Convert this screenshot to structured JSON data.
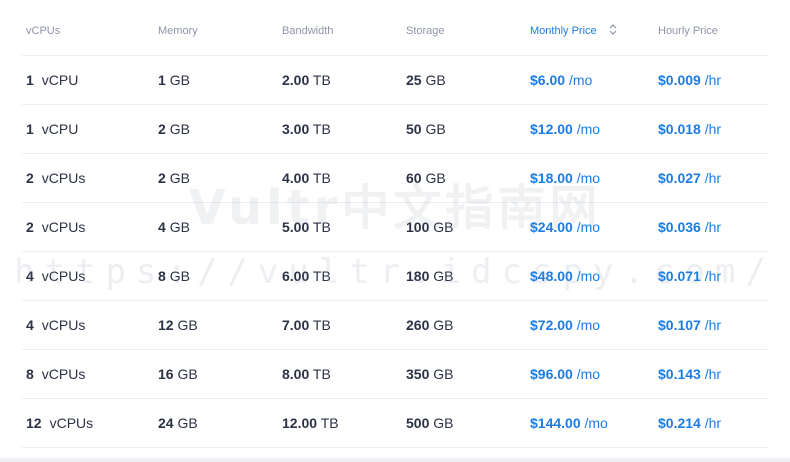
{
  "table": {
    "headers": {
      "vcpus": "vCPUs",
      "memory": "Memory",
      "bandwidth": "Bandwidth",
      "storage": "Storage",
      "monthly": "Monthly Price",
      "hourly": "Hourly Price"
    },
    "sort_icon": "sort-updown-icon",
    "rows": [
      {
        "cpu": "1",
        "cpu_unit": "vCPU",
        "mem": "1",
        "mem_unit": "GB",
        "bw": "2.00",
        "bw_unit": "TB",
        "storage": "25",
        "storage_unit": "GB",
        "monthly": "$6.00",
        "monthly_unit": "/mo",
        "hourly": "$0.009",
        "hourly_unit": "/hr"
      },
      {
        "cpu": "1",
        "cpu_unit": "vCPU",
        "mem": "2",
        "mem_unit": "GB",
        "bw": "3.00",
        "bw_unit": "TB",
        "storage": "50",
        "storage_unit": "GB",
        "monthly": "$12.00",
        "monthly_unit": "/mo",
        "hourly": "$0.018",
        "hourly_unit": "/hr"
      },
      {
        "cpu": "2",
        "cpu_unit": "vCPUs",
        "mem": "2",
        "mem_unit": "GB",
        "bw": "4.00",
        "bw_unit": "TB",
        "storage": "60",
        "storage_unit": "GB",
        "monthly": "$18.00",
        "monthly_unit": "/mo",
        "hourly": "$0.027",
        "hourly_unit": "/hr"
      },
      {
        "cpu": "2",
        "cpu_unit": "vCPUs",
        "mem": "4",
        "mem_unit": "GB",
        "bw": "5.00",
        "bw_unit": "TB",
        "storage": "100",
        "storage_unit": "GB",
        "monthly": "$24.00",
        "monthly_unit": "/mo",
        "hourly": "$0.036",
        "hourly_unit": "/hr"
      },
      {
        "cpu": "4",
        "cpu_unit": "vCPUs",
        "mem": "8",
        "mem_unit": "GB",
        "bw": "6.00",
        "bw_unit": "TB",
        "storage": "180",
        "storage_unit": "GB",
        "monthly": "$48.00",
        "monthly_unit": "/mo",
        "hourly": "$0.071",
        "hourly_unit": "/hr"
      },
      {
        "cpu": "4",
        "cpu_unit": "vCPUs",
        "mem": "12",
        "mem_unit": "GB",
        "bw": "7.00",
        "bw_unit": "TB",
        "storage": "260",
        "storage_unit": "GB",
        "monthly": "$72.00",
        "monthly_unit": "/mo",
        "hourly": "$0.107",
        "hourly_unit": "/hr"
      },
      {
        "cpu": "8",
        "cpu_unit": "vCPUs",
        "mem": "16",
        "mem_unit": "GB",
        "bw": "8.00",
        "bw_unit": "TB",
        "storage": "350",
        "storage_unit": "GB",
        "monthly": "$96.00",
        "monthly_unit": "/mo",
        "hourly": "$0.143",
        "hourly_unit": "/hr"
      },
      {
        "cpu": "12",
        "cpu_unit": "vCPUs",
        "mem": "24",
        "mem_unit": "GB",
        "bw": "12.00",
        "bw_unit": "TB",
        "storage": "500",
        "storage_unit": "GB",
        "monthly": "$144.00",
        "monthly_unit": "/mo",
        "hourly": "$0.214",
        "hourly_unit": "/hr"
      }
    ]
  },
  "watermark": {
    "title": "Vultr中文指南网",
    "url": "https://vultr.idcspy.com/"
  },
  "colors": {
    "accent": "#1a7de6",
    "text": "#2c3245",
    "header_text": "#8e95a6"
  }
}
